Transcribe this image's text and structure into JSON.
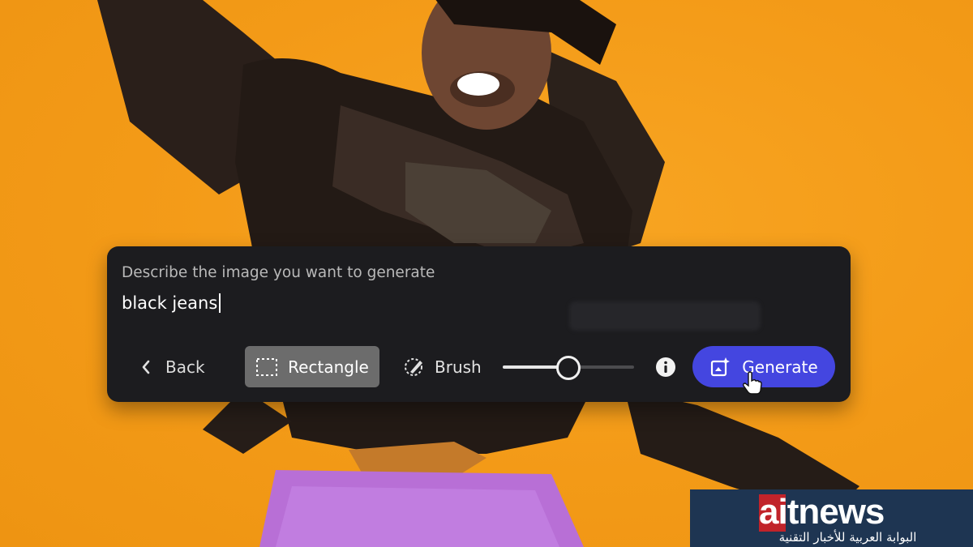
{
  "prompt": {
    "label": "Describe the image you want to generate",
    "value": "black jeans"
  },
  "toolbar": {
    "back_label": "Back",
    "rectangle_label": "Rectangle",
    "brush_label": "Brush",
    "brush_size_fraction": 0.5,
    "generate_label": "Generate"
  },
  "icons": {
    "back": "chevron-left-icon",
    "rectangle": "dashed-rectangle-icon",
    "brush": "brush-icon",
    "info": "info-icon",
    "generate": "image-sparkle-icon",
    "pointer": "hand-cursor-icon"
  },
  "brand": {
    "name": "aitnews",
    "tagline": "البوابة العربية للأخبار التقنية"
  },
  "colors": {
    "background": "#f59e1a",
    "panel": "#1c1c1f",
    "selected_tool": "#6c6c6c",
    "accent": "#4446e0",
    "brand_bg": "#1e3552",
    "brand_red": "#c1232a"
  }
}
